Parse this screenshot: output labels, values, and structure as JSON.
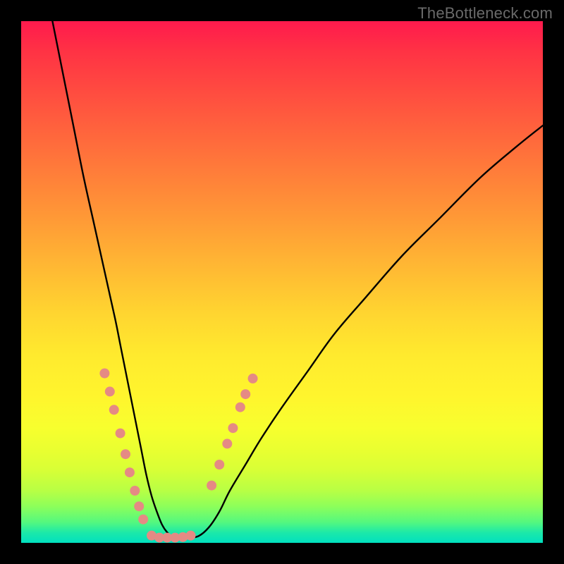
{
  "watermark": "TheBottleneck.com",
  "chart_data": {
    "type": "line",
    "title": "",
    "xlabel": "",
    "ylabel": "",
    "xlim": [
      0,
      100
    ],
    "ylim": [
      0,
      100
    ],
    "grid": false,
    "legend": false,
    "series": [
      {
        "name": "bottleneck-curve",
        "color": "#000000",
        "x": [
          6,
          8,
          10,
          12,
          14,
          16,
          18,
          19,
          20,
          21,
          22,
          23,
          24,
          25,
          26,
          27,
          28,
          29,
          30,
          32,
          34,
          36,
          38,
          40,
          43,
          46,
          50,
          55,
          60,
          66,
          73,
          80,
          88,
          95,
          100
        ],
        "y": [
          100,
          90,
          80,
          70,
          61,
          52,
          43,
          38,
          33,
          28,
          23,
          18,
          13,
          9,
          6,
          3.5,
          2,
          1.2,
          1,
          1,
          1.3,
          3,
          6,
          10,
          15,
          20,
          26,
          33,
          40,
          47,
          55,
          62,
          70,
          76,
          80
        ]
      }
    ],
    "markers": [
      {
        "name": "left-branch-dots",
        "color": "#e58a84",
        "radius_px": 7,
        "points": [
          {
            "x": 16.0,
            "y": 32.5
          },
          {
            "x": 17.0,
            "y": 29.0
          },
          {
            "x": 17.8,
            "y": 25.5
          },
          {
            "x": 19.0,
            "y": 21.0
          },
          {
            "x": 20.0,
            "y": 17.0
          },
          {
            "x": 20.8,
            "y": 13.5
          },
          {
            "x": 21.8,
            "y": 10.0
          },
          {
            "x": 22.6,
            "y": 7.0
          },
          {
            "x": 23.4,
            "y": 4.5
          }
        ]
      },
      {
        "name": "bottom-dots",
        "color": "#e58a84",
        "radius_px": 7,
        "points": [
          {
            "x": 25.0,
            "y": 1.4
          },
          {
            "x": 26.5,
            "y": 1.0
          },
          {
            "x": 28.0,
            "y": 1.0
          },
          {
            "x": 29.5,
            "y": 1.0
          },
          {
            "x": 31.0,
            "y": 1.1
          },
          {
            "x": 32.5,
            "y": 1.4
          }
        ]
      },
      {
        "name": "right-branch-dots",
        "color": "#e58a84",
        "radius_px": 7,
        "points": [
          {
            "x": 36.5,
            "y": 11.0
          },
          {
            "x": 38.0,
            "y": 15.0
          },
          {
            "x": 39.5,
            "y": 19.0
          },
          {
            "x": 40.6,
            "y": 22.0
          },
          {
            "x": 42.0,
            "y": 26.0
          },
          {
            "x": 43.0,
            "y": 28.5
          },
          {
            "x": 44.4,
            "y": 31.5
          }
        ]
      }
    ]
  }
}
